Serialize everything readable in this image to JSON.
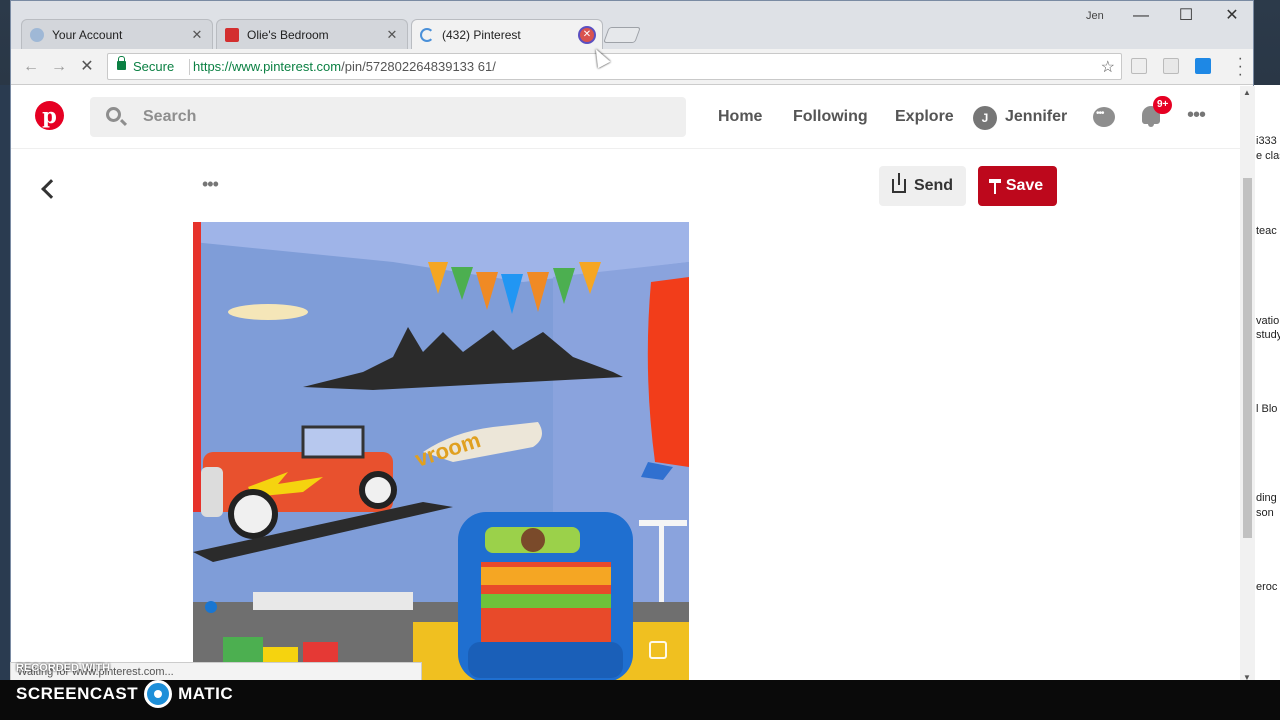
{
  "window": {
    "user": "Jen",
    "controls": [
      "—",
      "☐",
      "✕"
    ]
  },
  "tabs": [
    {
      "label": "Your Account",
      "favicon_color": "#9fb8d6",
      "close": "✕"
    },
    {
      "label": "Olie's Bedroom",
      "favicon_color": "#d32f2f",
      "close": "✕"
    },
    {
      "label": "(432) Pinterest",
      "favicon_color": "#4a90d9",
      "close": "✕"
    }
  ],
  "toolbar": {
    "back": "←",
    "forward": "→",
    "reload": "✕",
    "secure_label": "Secure",
    "url_host": "https://www.pinterest.com",
    "url_path": "/pin/572802264839133 61/",
    "bookmark": "☆"
  },
  "pinterest": {
    "logo": "p",
    "search_placeholder": "Search",
    "nav": {
      "home": "Home",
      "following": "Following",
      "explore": "Explore",
      "user_initial": "J",
      "user_name": "Jennifer",
      "notification_badge": "9+",
      "more": "•••"
    },
    "pin": {
      "more": "•••",
      "send_label": "Send",
      "save_label": "Save",
      "image_alt": "Olie's Bedroom"
    }
  },
  "status_text": "Waiting for www.pinterest.com...",
  "desktop_icons": [
    "i333",
    "e clas",
    "teac",
    "vatio",
    "study",
    "l Blo",
    "ding",
    "son",
    "eroc"
  ],
  "watermark": {
    "recorded": "RECORDED WITH",
    "brand_left": "SCREENCAST",
    "brand_right": "MATIC"
  },
  "colors": {
    "pinterest_red": "#e60023",
    "save_red": "#bd081c",
    "secure_green": "#0b8043"
  }
}
